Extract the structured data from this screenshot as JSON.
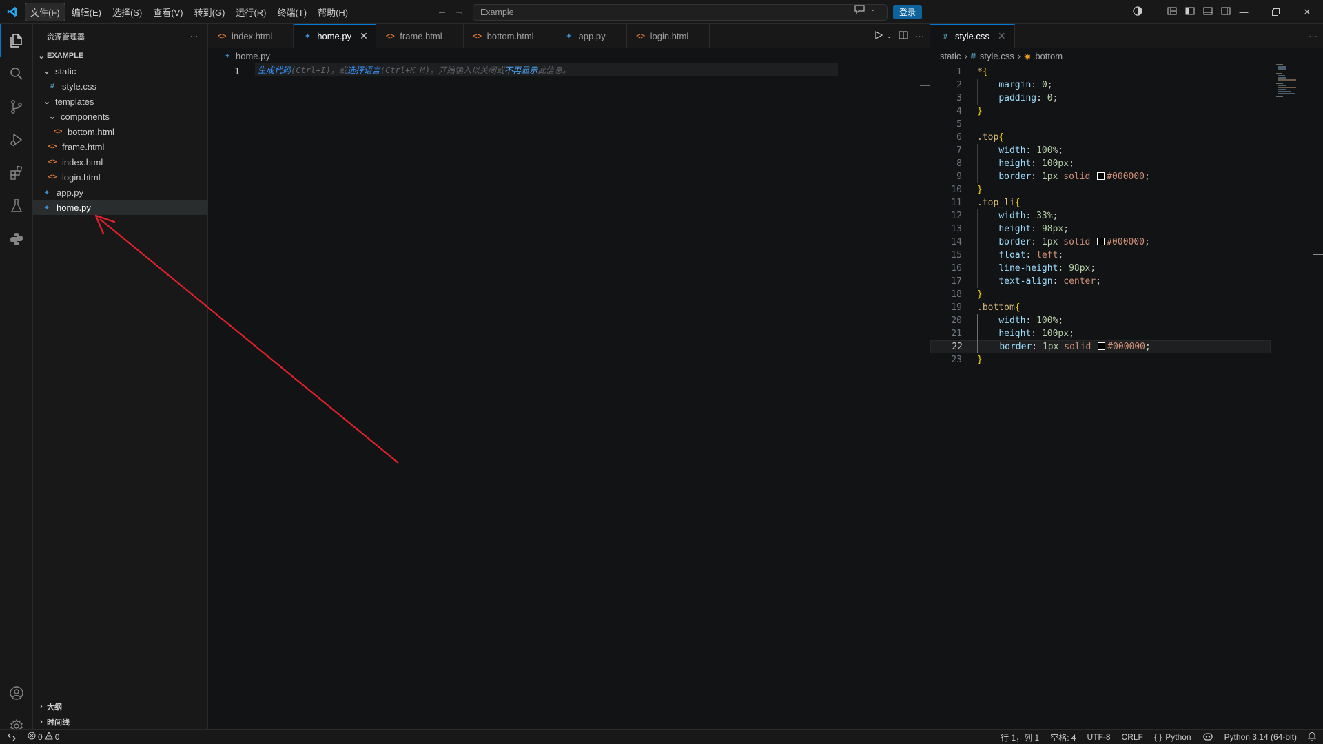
{
  "titlebar": {
    "menus": [
      "文件(F)",
      "编辑(E)",
      "选择(S)",
      "查看(V)",
      "转到(G)",
      "运行(R)",
      "终端(T)",
      "帮助(H)"
    ],
    "search_text": "Example",
    "login_label": "登录"
  },
  "sidebar": {
    "title": "资源管理器",
    "root": "EXAMPLE",
    "items": [
      {
        "label": "static",
        "type": "folder",
        "depth": 1
      },
      {
        "label": "style.css",
        "type": "css",
        "depth": 2
      },
      {
        "label": "templates",
        "type": "folder",
        "depth": 1
      },
      {
        "label": "components",
        "type": "folder",
        "depth": 2
      },
      {
        "label": "bottom.html",
        "type": "html",
        "depth": 3
      },
      {
        "label": "frame.html",
        "type": "html",
        "depth": 2
      },
      {
        "label": "index.html",
        "type": "html",
        "depth": 2
      },
      {
        "label": "login.html",
        "type": "html",
        "depth": 2
      },
      {
        "label": "app.py",
        "type": "py",
        "depth": 1
      },
      {
        "label": "home.py",
        "type": "py",
        "depth": 1,
        "selected": true
      }
    ],
    "outline_label": "大纲",
    "timeline_label": "时间线"
  },
  "group1": {
    "tabs": [
      {
        "label": "index.html",
        "type": "html"
      },
      {
        "label": "home.py",
        "type": "py",
        "active": true
      },
      {
        "label": "frame.html",
        "type": "html"
      },
      {
        "label": "bottom.html",
        "type": "html"
      },
      {
        "label": "app.py",
        "type": "py"
      },
      {
        "label": "login.html",
        "type": "html"
      }
    ],
    "breadcrumb": "home.py",
    "line_number": "1",
    "hint": {
      "p1": "生成代码",
      "p2": "(Ctrl+I)，或",
      "p3": "选择语言",
      "p4": "(Ctrl+K M)。开始输入以关闭或",
      "p5": "不再显示",
      "p6": "此信息。"
    }
  },
  "group2": {
    "tab_label": "style.css",
    "breadcrumb": {
      "folder": "static",
      "file": "style.css",
      "symbol": ".bottom"
    },
    "current_line": 22,
    "lines": [
      [
        [
          "t-sel",
          "*"
        ],
        [
          "t-brace",
          "{"
        ]
      ],
      [
        [
          "",
          "    "
        ],
        [
          "t-prop",
          "margin"
        ],
        [
          "t-punct",
          ": "
        ],
        [
          "t-num",
          "0"
        ],
        [
          "t-punct",
          ";"
        ]
      ],
      [
        [
          "",
          "    "
        ],
        [
          "t-prop",
          "padding"
        ],
        [
          "t-punct",
          ": "
        ],
        [
          "t-num",
          "0"
        ],
        [
          "t-punct",
          ";"
        ]
      ],
      [
        [
          "t-brace",
          "}"
        ]
      ],
      [],
      [
        [
          "t-sel",
          ".top"
        ],
        [
          "t-brace",
          "{"
        ]
      ],
      [
        [
          "",
          "    "
        ],
        [
          "t-prop",
          "width"
        ],
        [
          "t-punct",
          ": "
        ],
        [
          "t-num",
          "100%"
        ],
        [
          "t-punct",
          ";"
        ]
      ],
      [
        [
          "",
          "    "
        ],
        [
          "t-prop",
          "height"
        ],
        [
          "t-punct",
          ": "
        ],
        [
          "t-num",
          "100px"
        ],
        [
          "t-punct",
          ";"
        ]
      ],
      [
        [
          "",
          "    "
        ],
        [
          "t-prop",
          "border"
        ],
        [
          "t-punct",
          ": "
        ],
        [
          "t-num",
          "1px"
        ],
        [
          "t-punct",
          " "
        ],
        [
          "t-val",
          "solid"
        ],
        [
          "t-punct",
          " "
        ],
        [
          "swatch",
          ""
        ],
        [
          "t-val",
          "#000000"
        ],
        [
          "t-punct",
          ";"
        ]
      ],
      [
        [
          "t-brace",
          "}"
        ]
      ],
      [
        [
          "t-sel",
          ".top_li"
        ],
        [
          "t-brace",
          "{"
        ]
      ],
      [
        [
          "",
          "    "
        ],
        [
          "t-prop",
          "width"
        ],
        [
          "t-punct",
          ": "
        ],
        [
          "t-num",
          "33%"
        ],
        [
          "t-punct",
          ";"
        ]
      ],
      [
        [
          "",
          "    "
        ],
        [
          "t-prop",
          "height"
        ],
        [
          "t-punct",
          ": "
        ],
        [
          "t-num",
          "98px"
        ],
        [
          "t-punct",
          ";"
        ]
      ],
      [
        [
          "",
          "    "
        ],
        [
          "t-prop",
          "border"
        ],
        [
          "t-punct",
          ": "
        ],
        [
          "t-num",
          "1px"
        ],
        [
          "t-punct",
          " "
        ],
        [
          "t-val",
          "solid"
        ],
        [
          "t-punct",
          " "
        ],
        [
          "swatch",
          ""
        ],
        [
          "t-val",
          "#000000"
        ],
        [
          "t-punct",
          ";"
        ]
      ],
      [
        [
          "",
          "    "
        ],
        [
          "t-prop",
          "float"
        ],
        [
          "t-punct",
          ": "
        ],
        [
          "t-val",
          "left"
        ],
        [
          "t-punct",
          ";"
        ]
      ],
      [
        [
          "",
          "    "
        ],
        [
          "t-prop",
          "line-height"
        ],
        [
          "t-punct",
          ": "
        ],
        [
          "t-num",
          "98px"
        ],
        [
          "t-punct",
          ";"
        ]
      ],
      [
        [
          "",
          "    "
        ],
        [
          "t-prop",
          "text-align"
        ],
        [
          "t-punct",
          ": "
        ],
        [
          "t-val",
          "center"
        ],
        [
          "t-punct",
          ";"
        ]
      ],
      [
        [
          "t-brace",
          "}"
        ]
      ],
      [
        [
          "t-sel",
          ".bottom"
        ],
        [
          "t-brace",
          "{"
        ]
      ],
      [
        [
          "",
          "    "
        ],
        [
          "t-prop",
          "width"
        ],
        [
          "t-punct",
          ": "
        ],
        [
          "t-num",
          "100%"
        ],
        [
          "t-punct",
          ";"
        ]
      ],
      [
        [
          "",
          "    "
        ],
        [
          "t-prop",
          "height"
        ],
        [
          "t-punct",
          ": "
        ],
        [
          "t-num",
          "100px"
        ],
        [
          "t-punct",
          ";"
        ]
      ],
      [
        [
          "",
          "    "
        ],
        [
          "t-prop",
          "border"
        ],
        [
          "t-punct",
          ": "
        ],
        [
          "t-num",
          "1px"
        ],
        [
          "t-punct",
          " "
        ],
        [
          "t-val",
          "solid"
        ],
        [
          "t-punct",
          " "
        ],
        [
          "swatch",
          ""
        ],
        [
          "t-val",
          "#000000"
        ],
        [
          "t-punct",
          ";"
        ]
      ],
      [
        [
          "t-brace",
          "}"
        ]
      ]
    ]
  },
  "statusbar": {
    "errors": "0",
    "warnings": "0",
    "position": "行 1，列 1",
    "spaces": "空格: 4",
    "encoding": "UTF-8",
    "eol": "CRLF",
    "language": "Python",
    "interpreter": "Python 3.14 (64-bit)"
  },
  "colors": {
    "accent": "#0078d4",
    "annotation_arrow": "#e0202a",
    "login_button": "#0e639c"
  }
}
